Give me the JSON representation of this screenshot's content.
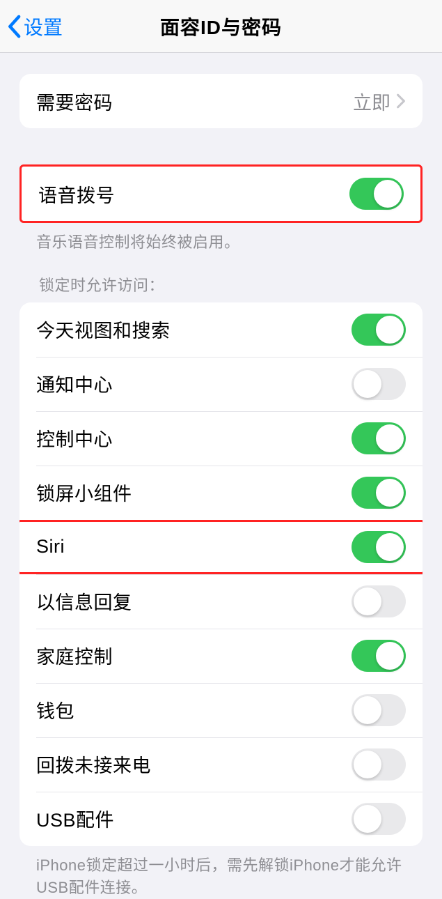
{
  "nav": {
    "back": "设置",
    "title": "面容ID与密码"
  },
  "requirePasscode": {
    "label": "需要密码",
    "value": "立即"
  },
  "voiceDial": {
    "label": "语音拨号",
    "on": true,
    "footer": "音乐语音控制将始终被启用。"
  },
  "lockAccess": {
    "header": "锁定时允许访问：",
    "items": [
      {
        "label": "今天视图和搜索",
        "on": true
      },
      {
        "label": "通知中心",
        "on": false
      },
      {
        "label": "控制中心",
        "on": true
      },
      {
        "label": "锁屏小组件",
        "on": true
      },
      {
        "label": "Siri",
        "on": true
      },
      {
        "label": "以信息回复",
        "on": false
      },
      {
        "label": "家庭控制",
        "on": true
      },
      {
        "label": "钱包",
        "on": false
      },
      {
        "label": "回拨未接来电",
        "on": false
      },
      {
        "label": "USB配件",
        "on": false
      }
    ],
    "footer": "iPhone锁定超过一小时后，需先解锁iPhone才能允许USB配件连接。"
  }
}
